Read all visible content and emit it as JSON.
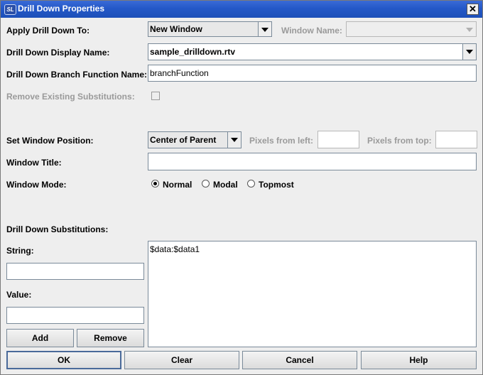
{
  "window": {
    "title": "Drill Down Properties",
    "icon_label": "SL",
    "close_symbol": "✕"
  },
  "apply": {
    "label": "Apply Drill Down To:",
    "value": "New Window",
    "window_name_label": "Window Name:",
    "window_name_value": ""
  },
  "display_name": {
    "label": "Drill Down Display Name:",
    "value": "sample_drilldown.rtv"
  },
  "branch_function": {
    "label": "Drill Down Branch Function Name:",
    "value": "branchFunction"
  },
  "remove_subs": {
    "label": "Remove Existing Substitutions:",
    "checked": false
  },
  "position": {
    "label": "Set Window Position:",
    "value": "Center of Parent",
    "pixels_left_label": "Pixels from left:",
    "pixels_left_value": "",
    "pixels_top_label": "Pixels from top:",
    "pixels_top_value": ""
  },
  "window_title": {
    "label": "Window Title:",
    "value": ""
  },
  "window_mode": {
    "label": "Window Mode:",
    "options": [
      "Normal",
      "Modal",
      "Topmost"
    ],
    "selected": "Normal"
  },
  "substitutions": {
    "label": "Drill Down Substitutions:",
    "string_label": "String:",
    "string_value": "",
    "value_label": "Value:",
    "value_value": "",
    "add_label": "Add",
    "remove_label": "Remove",
    "list_text": "$data:$data1"
  },
  "footer": {
    "ok_label": "OK",
    "clear_label": "Clear",
    "cancel_label": "Cancel",
    "help_label": "Help"
  },
  "colors": {
    "titlebar": "#2458c8",
    "window_bg": "#eeeeee",
    "disabled_text": "#9a9a9a"
  }
}
